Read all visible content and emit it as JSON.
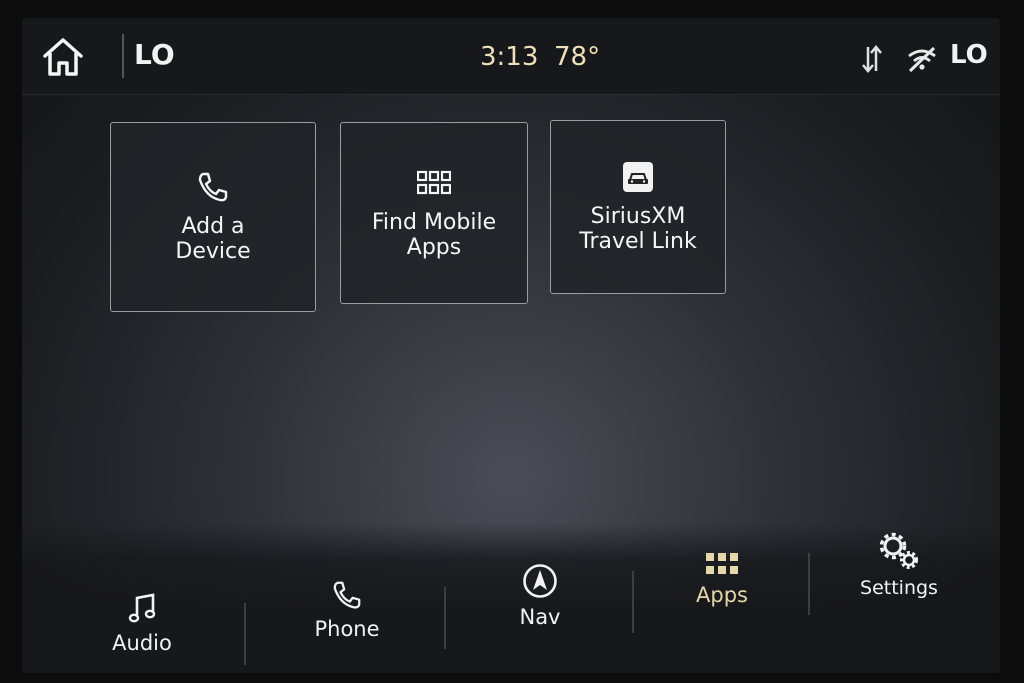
{
  "topbar": {
    "left_temp": "LO",
    "time": "3:13",
    "outside_temp": "78°",
    "right_temp": "LO",
    "icons": [
      "home-icon",
      "sync-icon",
      "wifi-off-icon"
    ]
  },
  "tiles": [
    {
      "label": "Add a\nDevice",
      "icon": "phone-icon"
    },
    {
      "label": "Find Mobile\nApps",
      "icon": "apps-grid-icon"
    },
    {
      "label": "SiriusXM\nTravel Link",
      "icon": "car-icon"
    }
  ],
  "nav": {
    "audio": "Audio",
    "phone": "Phone",
    "nav": "Nav",
    "apps": "Apps",
    "settings": "Settings"
  },
  "colors": {
    "accent_gold": "#efe0b8",
    "active_apps": "#e6d7a8",
    "text": "#f2f2f2"
  }
}
